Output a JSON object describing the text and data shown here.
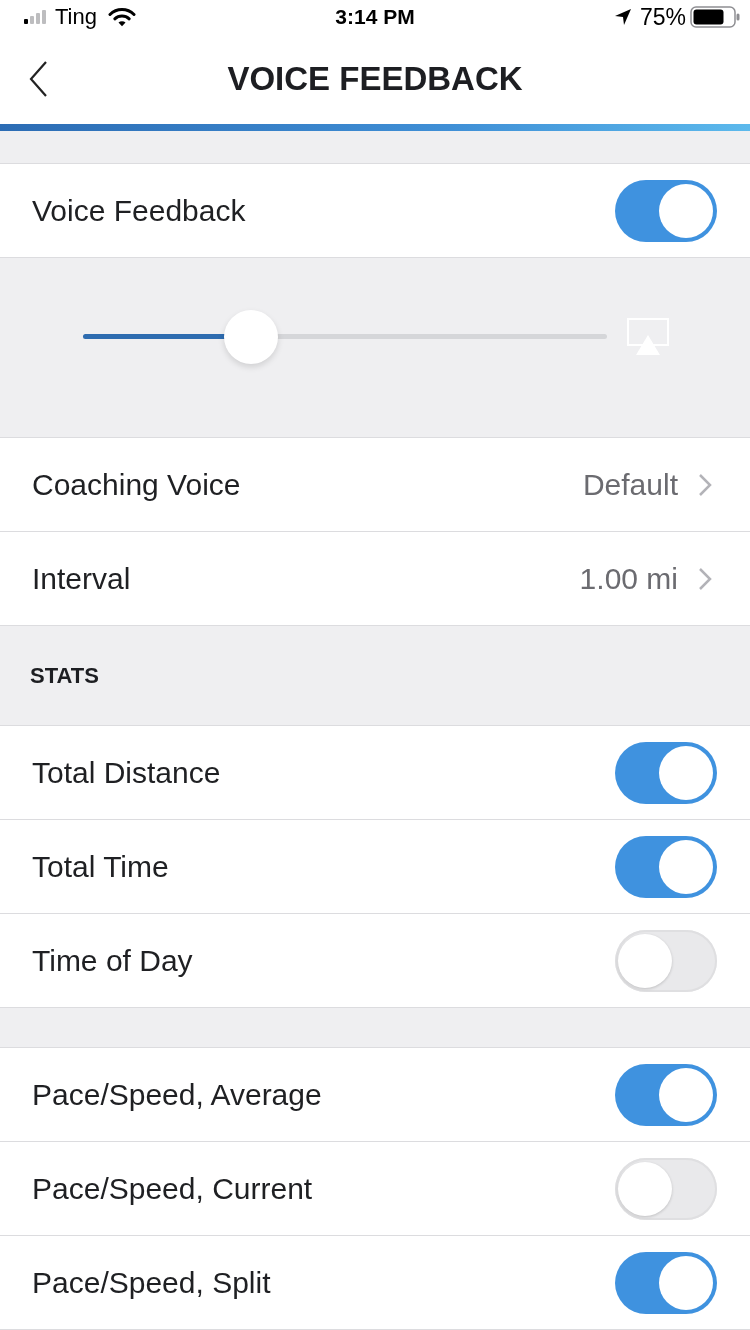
{
  "status_bar": {
    "carrier": "Ting",
    "time": "3:14 PM",
    "battery": "75%"
  },
  "header": {
    "title": "VOICE FEEDBACK"
  },
  "groups": [
    {
      "rows": [
        {
          "kind": "toggle",
          "label": "Voice Feedback",
          "on": true
        },
        {
          "kind": "slider",
          "level": 0.32
        },
        {
          "kind": "link",
          "label": "Coaching Voice",
          "value": "Default"
        },
        {
          "kind": "link",
          "label": "Interval",
          "value": "1.00 mi"
        }
      ]
    },
    {
      "header": "STATS",
      "rows": [
        {
          "kind": "toggle",
          "label": "Total Distance",
          "on": true
        },
        {
          "kind": "toggle",
          "label": "Total Time",
          "on": true
        },
        {
          "kind": "toggle",
          "label": "Time of Day",
          "on": false
        }
      ]
    },
    {
      "rows": [
        {
          "kind": "toggle",
          "label": "Pace/Speed, Average",
          "on": true
        },
        {
          "kind": "toggle",
          "label": "Pace/Speed, Current",
          "on": false
        },
        {
          "kind": "toggle",
          "label": "Pace/Speed, Split",
          "on": true
        }
      ]
    }
  ]
}
